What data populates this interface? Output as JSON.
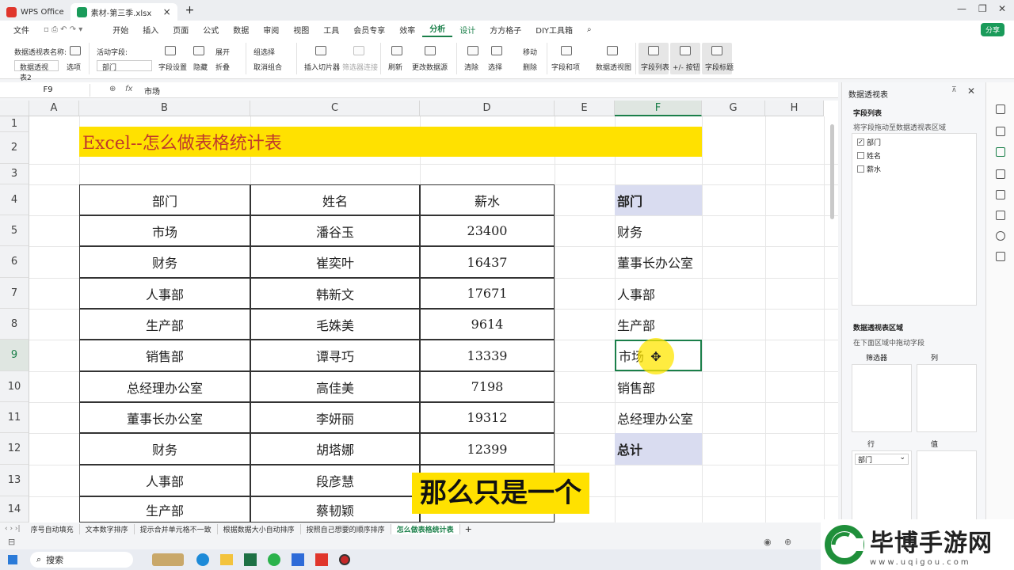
{
  "titlebar": {
    "app_tab": "WPS Office",
    "file_tab": "素材-第三季.xlsx",
    "close_icon": "×",
    "new_tab": "+"
  },
  "menubar": {
    "file": "文件",
    "items": [
      "开始",
      "插入",
      "页面",
      "公式",
      "数据",
      "审阅",
      "视图",
      "工具",
      "会员专享",
      "效率",
      "分析",
      "设计",
      "方方格子",
      "DIY工具箱"
    ],
    "share": "分享"
  },
  "ribbon": {
    "pivot_name_label": "数据透视表名称:",
    "pivot_name_value": "数据透视表2",
    "options": "选项",
    "active_field_label": "活动字段:",
    "active_field_value": "部门",
    "field_settings": "字段设置",
    "hide": "隐藏",
    "expand": "展开",
    "collapse": "折叠",
    "group_selection": "组选择",
    "ungroup": "取消组合",
    "insert_slicer": "插入切片器",
    "filter_connection": "筛选器连接",
    "refresh": "刷新",
    "change_source": "更改数据源",
    "clear": "清除",
    "select": "选择",
    "move": "移动",
    "delete": "删除",
    "fields_items": "字段和项",
    "pivot_chart": "数据透视图",
    "field_list": "字段列表",
    "plus_minus": "+/- 按钮",
    "field_headers": "字段标题"
  },
  "formula": {
    "cell_ref": "F9",
    "fx": "fx",
    "value": "市场"
  },
  "columns": [
    "A",
    "B",
    "C",
    "D",
    "E",
    "F",
    "G",
    "H"
  ],
  "rows": [
    "1",
    "2",
    "3",
    "4",
    "5",
    "6",
    "7",
    "8",
    "9",
    "10",
    "11",
    "12",
    "13",
    "14"
  ],
  "sheet_title": "Excel--怎么做表格统计表",
  "table": {
    "headers": [
      "部门",
      "姓名",
      "薪水"
    ],
    "rows": [
      [
        "市场",
        "潘谷玉",
        "23400"
      ],
      [
        "财务",
        "崔奕叶",
        "16437"
      ],
      [
        "人事部",
        "韩新文",
        "17671"
      ],
      [
        "生产部",
        "毛姝美",
        "9614"
      ],
      [
        "销售部",
        "谭寻巧",
        "13339"
      ],
      [
        "总经理办公室",
        "高佳美",
        "7198"
      ],
      [
        "董事长办公室",
        "李妍丽",
        "19312"
      ],
      [
        "财务",
        "胡塔娜",
        "12399"
      ],
      [
        "人事部",
        "段彦慧",
        ""
      ],
      [
        "生产部",
        "蔡韧颖",
        ""
      ]
    ]
  },
  "pivot": {
    "header": "部门",
    "items": [
      "财务",
      "董事长办公室",
      "人事部",
      "生产部",
      "市场",
      "销售部",
      "总经理办公室"
    ],
    "total": "总计"
  },
  "subtitle": "那么只是一个",
  "sheet_tabs": [
    "序号自动填充",
    "文本数字排序",
    "提示合并单元格不一致",
    "根据数据大小自动排序",
    "按照自己想要的顺序排序",
    "怎么做表格统计表"
  ],
  "panel": {
    "title": "数据透视表",
    "field_list_title": "字段列表",
    "drag_hint": "将字段拖动至数据透视表区域",
    "fields": [
      {
        "label": "部门",
        "checked": true
      },
      {
        "label": "姓名",
        "checked": false
      },
      {
        "label": "薪水",
        "checked": false
      }
    ],
    "areas_title": "数据透视表区域",
    "areas_hint": "在下面区域中拖动字段",
    "filter": "筛选器",
    "columns": "列",
    "rows": "行",
    "values": "值",
    "row_field": "部门"
  },
  "taskbar": {
    "search": "搜索"
  },
  "watermark": {
    "brand": "毕博手游网",
    "url": "www.uqigou.com"
  },
  "colors": {
    "accent": "#1a7f49",
    "title_yellow": "#ffe100",
    "pivot_header": "#d9dcf0"
  }
}
